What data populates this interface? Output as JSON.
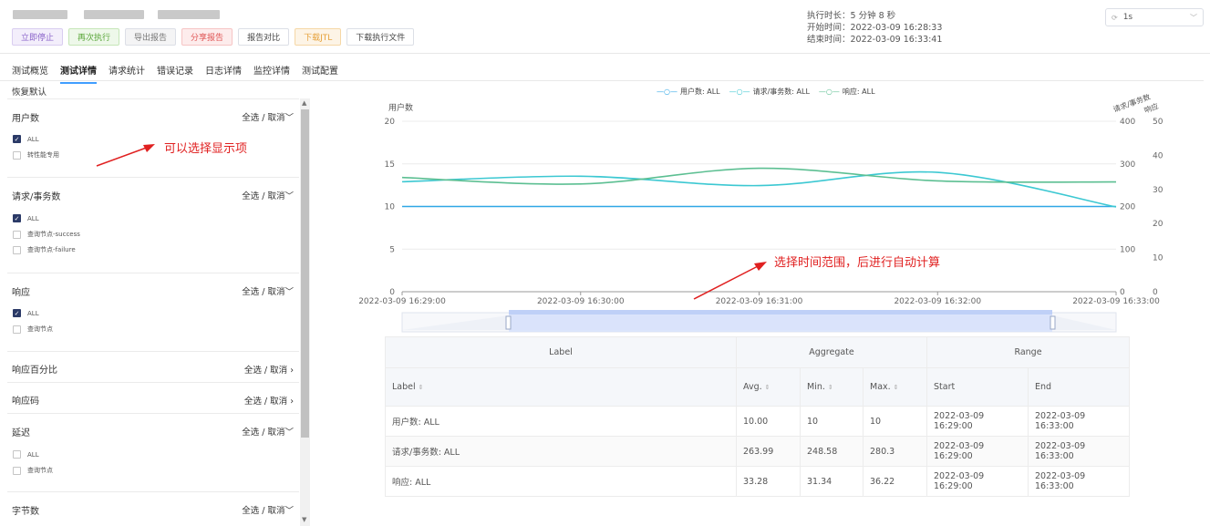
{
  "header": {
    "buttons": [
      "立即停止",
      "再次执行",
      "导出报告",
      "分享报告",
      "报告对比",
      "下载JTL",
      "下载执行文件"
    ],
    "exec_duration": "执行时长：5 分钟 8 秒",
    "start_time": "开始时间：2022-03-09 16:28:33",
    "end_time": "结束时间：2022-03-09 16:33:41",
    "refresh_value": "1s"
  },
  "tabs": [
    "测试概览",
    "测试详情",
    "请求统计",
    "错误记录",
    "日志详情",
    "监控详情",
    "测试配置"
  ],
  "active_tab": "测试详情",
  "sidebar": {
    "restore_label": "恢复默认",
    "select_all": "全选",
    "separator": " / ",
    "cancel": "取消",
    "sections": [
      {
        "title": "用户数",
        "options": [
          {
            "label": "ALL",
            "checked": true
          },
          {
            "label": "转性能专用",
            "checked": false
          }
        ]
      },
      {
        "title": "请求/事务数",
        "options": [
          {
            "label": "ALL",
            "checked": true
          },
          {
            "label": "查询节点-success",
            "checked": false
          },
          {
            "label": "查询节点-failure",
            "checked": false
          }
        ]
      },
      {
        "title": "响应",
        "options": [
          {
            "label": "ALL",
            "checked": true
          },
          {
            "label": "查询节点",
            "checked": false
          }
        ]
      },
      {
        "title": "响应百分比",
        "options": []
      },
      {
        "title": "响应码",
        "options": []
      },
      {
        "title": "延迟",
        "options": [
          {
            "label": "ALL",
            "checked": false
          },
          {
            "label": "查询节点",
            "checked": false
          }
        ]
      },
      {
        "title": "字节数",
        "options": []
      }
    ]
  },
  "annotations": {
    "select_items": "可以选择显示项",
    "select_range": "选择时间范围，后进行自动计算"
  },
  "chart_data": {
    "type": "line",
    "legend": [
      "用户数: ALL",
      "请求/事务数: ALL",
      "响应: ALL"
    ],
    "legend_position": "top-center",
    "x_ticks": [
      "2022-03-09 16:29:00",
      "2022-03-09 16:30:00",
      "2022-03-09 16:31:00",
      "2022-03-09 16:32:00",
      "2022-03-09 16:33:00"
    ],
    "y_left": {
      "label": "用户数",
      "ticks": [
        0,
        5,
        10,
        15,
        20
      ],
      "ylim": [
        0,
        20
      ]
    },
    "y_right1": {
      "label": "请求/事务数",
      "ticks": [
        0,
        100,
        200,
        300,
        400
      ],
      "ylim": [
        0,
        400
      ]
    },
    "y_right2": {
      "label": "响应",
      "ticks": [
        0,
        10,
        20,
        30,
        40,
        50
      ],
      "ylim": [
        0,
        50
      ]
    },
    "grid": true,
    "series": [
      {
        "name": "用户数: ALL",
        "axis": "left",
        "color": "#2fa7e6",
        "x": [
          "16:29:00",
          "16:30:00",
          "16:31:00",
          "16:32:00",
          "16:33:00"
        ],
        "values": [
          10,
          10,
          10,
          10,
          10
        ]
      },
      {
        "name": "请求/事务数: ALL",
        "axis": "right1",
        "color": "#3cc8d2",
        "x": [
          "16:29:00",
          "16:30:00",
          "16:31:00",
          "16:32:00",
          "16:33:00"
        ],
        "values": [
          258,
          271,
          249,
          280,
          199
        ]
      },
      {
        "name": "响应: ALL",
        "axis": "right2",
        "color": "#5cbf92",
        "x": [
          "16:29:00",
          "16:30:00",
          "16:31:00",
          "16:32:00",
          "16:33:00"
        ],
        "values": [
          33.5,
          31.6,
          36.2,
          32.5,
          32.2
        ]
      }
    ]
  },
  "stats_table": {
    "group_headers": [
      "Label",
      "Aggregate",
      "Range"
    ],
    "columns": [
      "Label",
      "Avg.",
      "Min.",
      "Max.",
      "Start",
      "End"
    ],
    "rows": [
      [
        "用户数: ALL",
        "10.00",
        "10",
        "10",
        "2022-03-09 16:29:00",
        "2022-03-09 16:33:00"
      ],
      [
        "请求/事务数: ALL",
        "263.99",
        "248.58",
        "280.3",
        "2022-03-09 16:29:00",
        "2022-03-09 16:33:00"
      ],
      [
        "响应: ALL",
        "33.28",
        "31.34",
        "36.22",
        "2022-03-09 16:29:00",
        "2022-03-09 16:33:00"
      ]
    ]
  }
}
